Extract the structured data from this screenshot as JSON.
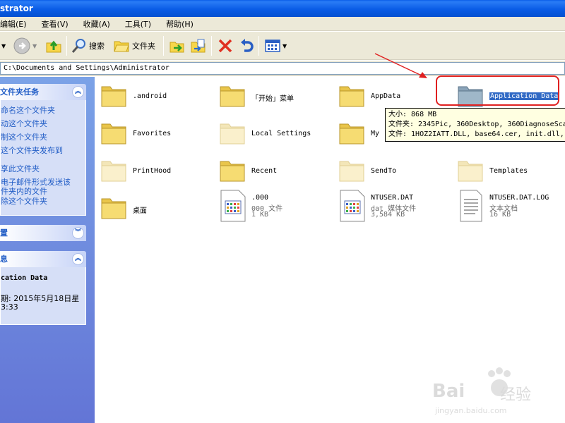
{
  "window": {
    "title": "strator"
  },
  "menubar": {
    "items": [
      "编辑(E)",
      "查看(V)",
      "收藏(A)",
      "工具(T)",
      "帮助(H)"
    ]
  },
  "toolbar": {
    "back_label": "",
    "search_label": "搜索",
    "folders_label": "文件夹"
  },
  "address": {
    "path": "C:\\Documents and Settings\\Administrator"
  },
  "sidebar": {
    "tasks_title": "文件夹任务",
    "tasks": [
      "命名这个文件夹",
      "动这个文件夹",
      "制这个文件夹",
      "这个文件夹发布到",
      "享此文件夹",
      "电子邮件形式发送该",
      "件夹内的文件",
      "除这个文件夹"
    ],
    "other_title": "置",
    "details_title": "息",
    "details_name": "cation Data",
    "details_date_1": "期: 2015年5月18日星",
    "details_date_2": "3:33"
  },
  "items": [
    {
      "name": ".android",
      "kind": "folder"
    },
    {
      "name": "「开始」菜单",
      "kind": "folder"
    },
    {
      "name": "AppData",
      "kind": "folder"
    },
    {
      "name": "Application Data",
      "kind": "folder-system",
      "selected": true
    },
    {
      "name": "Favorites",
      "kind": "folder"
    },
    {
      "name": "Local Settings",
      "kind": "folder-hidden"
    },
    {
      "name": "My",
      "kind": "folder"
    },
    {
      "name": "",
      "kind": "none"
    },
    {
      "name": "PrintHood",
      "kind": "folder-hidden"
    },
    {
      "name": "Recent",
      "kind": "folder"
    },
    {
      "name": "SendTo",
      "kind": "folder-hidden"
    },
    {
      "name": "Templates",
      "kind": "folder-hidden"
    },
    {
      "name": "桌面",
      "kind": "folder"
    },
    {
      "name": ".000",
      "kind": "file-media",
      "type": "000 文件",
      "size": "1 KB"
    },
    {
      "name": "NTUSER.DAT",
      "kind": "file-media",
      "type": "dat 媒体文件",
      "size": "3,584 KB"
    },
    {
      "name": "NTUSER.DAT.LOG",
      "kind": "file-text",
      "type": "文本文档",
      "size": "16 KB"
    }
  ],
  "tooltip": {
    "line1": "大小: 868 MB",
    "line2": "文件夹: 2345Pic, 360Desktop, 360DiagnoseScan",
    "line3": "文件: 1HOZ2IATT.DLL, base64.cer, init.dll, L"
  },
  "watermark": {
    "line1": "Bai",
    "line2": "经验",
    "line3": "jingyan.baidu.com"
  },
  "colors": {
    "selection": "#316ac5",
    "annotation": "#e02020",
    "xp_blue": "#0a5ee8"
  }
}
